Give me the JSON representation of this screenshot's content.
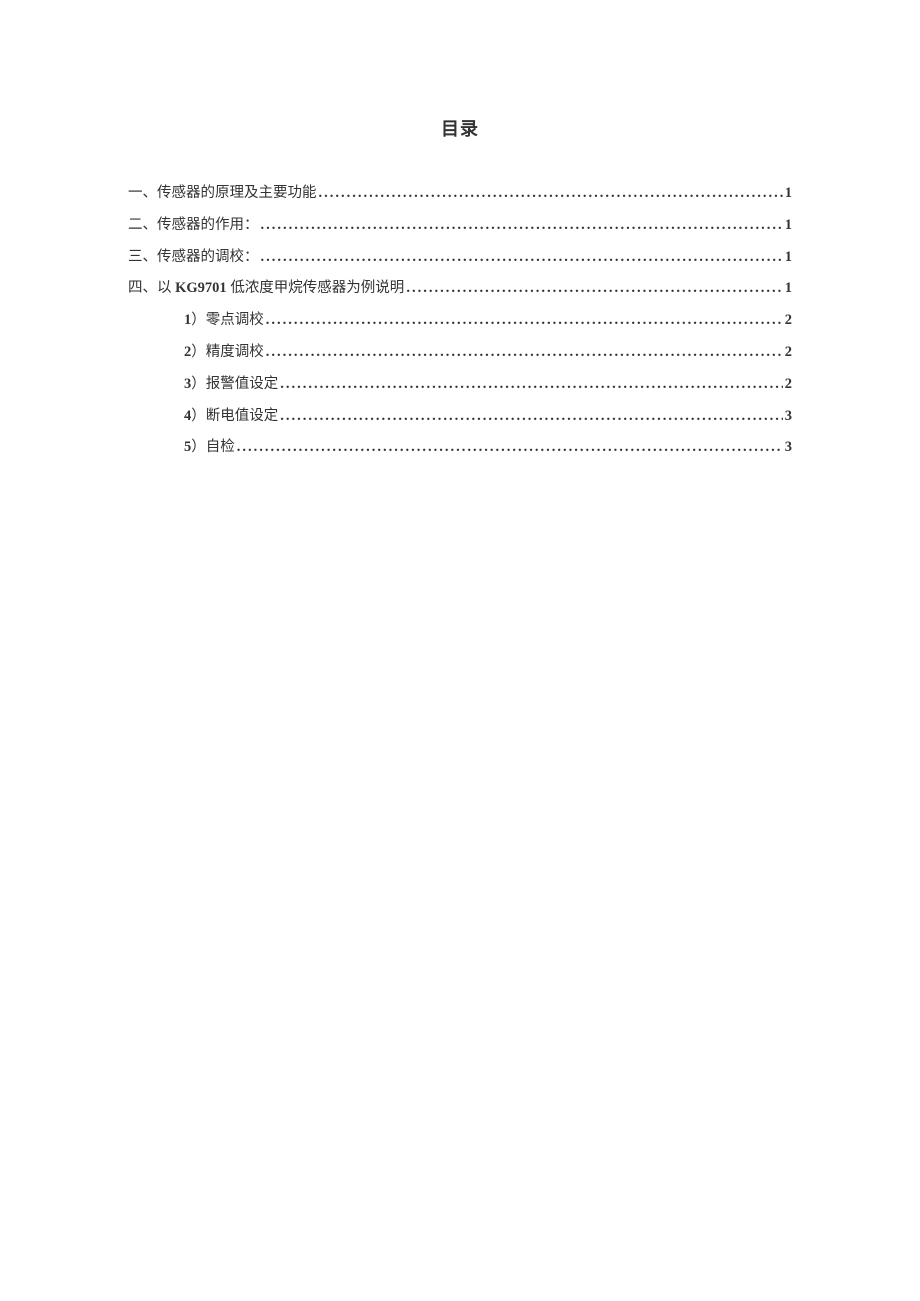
{
  "title": "目录",
  "entries": [
    {
      "label_prefix": "一、传感器的原理及主要功能 ",
      "label_bold": "",
      "page": "1",
      "sub": false
    },
    {
      "label_prefix": "二、传感器的作用： ",
      "label_bold": "",
      "page": "1",
      "sub": false
    },
    {
      "label_prefix": "三、传感器的调校： ",
      "label_bold": "",
      "page": "1",
      "sub": false
    },
    {
      "label_prefix": "四、以 ",
      "label_bold": "KG9701",
      "label_suffix": " 低浓度甲烷传感器为例说明 ",
      "page": "1",
      "sub": false
    },
    {
      "label_bold": "1",
      "label_suffix": "）零点调校 ",
      "page": "2",
      "sub": true
    },
    {
      "label_bold": "2",
      "label_suffix": "）精度调校 ",
      "page": "2",
      "sub": true
    },
    {
      "label_bold": "3",
      "label_suffix": "）报警值设定 ",
      "page": "2",
      "sub": true
    },
    {
      "label_bold": "4",
      "label_suffix": "）断电值设定 ",
      "page": "3",
      "sub": true
    },
    {
      "label_bold": "5",
      "label_suffix": "）自检 ",
      "page": "3",
      "sub": true
    }
  ]
}
